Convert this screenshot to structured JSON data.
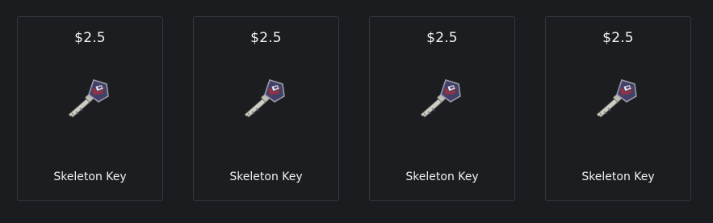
{
  "items": [
    {
      "price": "$2.5",
      "name": "Skeleton Key",
      "icon": "key-icon"
    },
    {
      "price": "$2.5",
      "name": "Skeleton Key",
      "icon": "key-icon"
    },
    {
      "price": "$2.5",
      "name": "Skeleton Key",
      "icon": "key-icon"
    },
    {
      "price": "$2.5",
      "name": "Skeleton Key",
      "icon": "key-icon"
    }
  ],
  "colors": {
    "background": "#1b1c20",
    "card_border": "#34363c",
    "text": "#f2f2f2",
    "key_head": "#3f4168",
    "key_accent": "#9a3040",
    "key_blade": "#d8d8d0"
  }
}
